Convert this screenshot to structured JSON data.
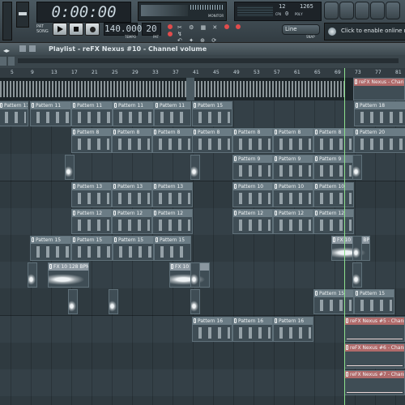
{
  "transport": {
    "time": "0:00:00",
    "bpm": "140.000",
    "tempo_label": "TEMPO",
    "pat": "20",
    "pat_label": "PAT",
    "monitor_label": "MONITOR",
    "cpu_label": "CPU",
    "poly_label": "POLY",
    "cpu_value": "12",
    "poly_value": "1265",
    "ram_value": "0",
    "snap_value": "Line",
    "snap_label": "SNAP",
    "hint": "Click to enable online ne"
  },
  "playlist": {
    "title": "Playlist - reFX Nexus #10 - Channel volume",
    "ruler": [
      "5",
      "9",
      "13",
      "17",
      "21",
      "25",
      "29",
      "33",
      "37",
      "41",
      "45",
      "49",
      "53",
      "57",
      "61",
      "65",
      "69",
      "73",
      "77",
      "81"
    ]
  },
  "colors": {
    "accent": "#6b7c85",
    "automation": "#b06a6a",
    "playhead": "#8de08d"
  },
  "clips": [
    {
      "lane": 0,
      "label": "Pattern 11",
      "kind": "pattern"
    },
    {
      "lane": 0,
      "label": "Pattern 11",
      "kind": "pattern"
    },
    {
      "lane": 0,
      "label": "Pattern 11",
      "kind": "pattern"
    },
    {
      "lane": 0,
      "label": "Pattern 11",
      "kind": "pattern"
    },
    {
      "lane": 0,
      "label": "Pattern 11",
      "kind": "pattern"
    },
    {
      "lane": 0,
      "label": "Pattern 15",
      "kind": "pattern"
    },
    {
      "lane": 0,
      "label": "Pattern 18",
      "kind": "pattern"
    },
    {
      "lane": 1,
      "label": "Pattern 8",
      "kind": "pattern"
    },
    {
      "lane": 1,
      "label": "Pattern 8",
      "kind": "pattern"
    },
    {
      "lane": 1,
      "label": "Pattern 8",
      "kind": "pattern"
    },
    {
      "lane": 1,
      "label": "Pattern 8",
      "kind": "pattern"
    },
    {
      "lane": 1,
      "label": "Pattern 8",
      "kind": "pattern"
    },
    {
      "lane": 1,
      "label": "Pattern 8",
      "kind": "pattern"
    },
    {
      "lane": 1,
      "label": "Pattern 8",
      "kind": "pattern"
    },
    {
      "lane": 1,
      "label": "Pattern 20",
      "kind": "pattern"
    },
    {
      "lane": 2,
      "label": "Pattern 9",
      "kind": "pattern"
    },
    {
      "lane": 2,
      "label": "Pattern 9",
      "kind": "pattern"
    },
    {
      "lane": 2,
      "label": "Pattern 9",
      "kind": "pattern"
    },
    {
      "lane": 3,
      "label": "Pattern 13",
      "kind": "pattern"
    },
    {
      "lane": 3,
      "label": "Pattern 13",
      "kind": "pattern"
    },
    {
      "lane": 3,
      "label": "Pattern 13",
      "kind": "pattern"
    },
    {
      "lane": 3,
      "label": "Pattern 13",
      "kind": "pattern"
    },
    {
      "lane": 3,
      "label": "Pattern 10",
      "kind": "pattern"
    },
    {
      "lane": 3,
      "label": "Pattern 10",
      "kind": "pattern"
    },
    {
      "lane": 3,
      "label": "Pattern 10",
      "kind": "pattern"
    },
    {
      "lane": 4,
      "label": "Pattern 12",
      "kind": "pattern"
    },
    {
      "lane": 4,
      "label": "Pattern 12",
      "kind": "pattern"
    },
    {
      "lane": 4,
      "label": "Pattern 12",
      "kind": "pattern"
    },
    {
      "lane": 4,
      "label": "Pattern 12",
      "kind": "pattern"
    },
    {
      "lane": 4,
      "label": "Pattern 12",
      "kind": "pattern"
    },
    {
      "lane": 4,
      "label": "Pattern 12",
      "kind": "pattern"
    },
    {
      "lane": 4,
      "label": "Pattern 12",
      "kind": "pattern"
    },
    {
      "lane": 5,
      "label": "Pattern 15",
      "kind": "pattern"
    },
    {
      "lane": 5,
      "label": "Pattern 15",
      "kind": "pattern"
    },
    {
      "lane": 5,
      "label": "Pattern 15",
      "kind": "pattern"
    },
    {
      "lane": 5,
      "label": "Pattern 15",
      "kind": "pattern"
    },
    {
      "lane": 5,
      "label": "FX 10 128 BPM",
      "kind": "audio"
    },
    {
      "lane": 6,
      "label": "FX 10 128 BPM",
      "kind": "audio"
    },
    {
      "lane": 6,
      "label": "FX 10 1",
      "kind": "audio"
    },
    {
      "lane": 7,
      "label": "Pattern 15",
      "kind": "pattern"
    },
    {
      "lane": 7,
      "label": "Pattern 15",
      "kind": "pattern"
    },
    {
      "lane": 7,
      "label": "Pattern 15",
      "kind": "pattern"
    },
    {
      "lane": 8,
      "label": "Pattern 16",
      "kind": "pattern"
    },
    {
      "lane": 8,
      "label": "Pattern 16",
      "kind": "pattern"
    },
    {
      "lane": 8,
      "label": "Pattern 16",
      "kind": "pattern"
    },
    {
      "lane": 8,
      "label": "reFX Nexus #5 - Channel vo",
      "kind": "auto"
    },
    {
      "lane": 9,
      "label": "reFX Nexus #6 - Channel vo",
      "kind": "auto"
    },
    {
      "lane": 10,
      "label": "reFX Nexus #7 - Channel vo",
      "kind": "auto"
    },
    {
      "lane": -1,
      "label": "reFX Nexus - Channel v",
      "kind": "auto"
    }
  ]
}
